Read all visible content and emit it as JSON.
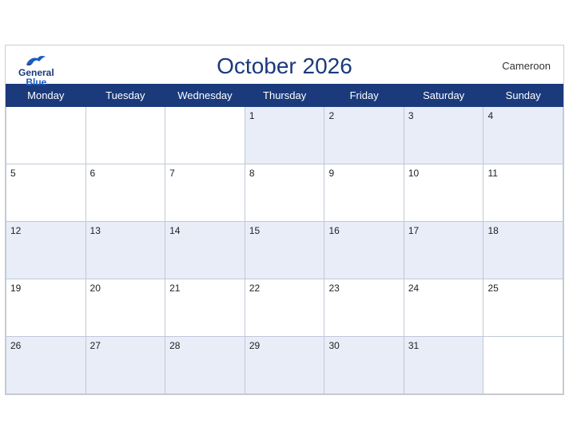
{
  "header": {
    "logo": {
      "general": "General",
      "blue": "Blue"
    },
    "title": "October 2026",
    "country": "Cameroon"
  },
  "weekdays": [
    "Monday",
    "Tuesday",
    "Wednesday",
    "Thursday",
    "Friday",
    "Saturday",
    "Sunday"
  ],
  "weeks": [
    [
      null,
      null,
      null,
      1,
      2,
      3,
      4
    ],
    [
      5,
      6,
      7,
      8,
      9,
      10,
      11
    ],
    [
      12,
      13,
      14,
      15,
      16,
      17,
      18
    ],
    [
      19,
      20,
      21,
      22,
      23,
      24,
      25
    ],
    [
      26,
      27,
      28,
      29,
      30,
      31,
      null
    ]
  ]
}
